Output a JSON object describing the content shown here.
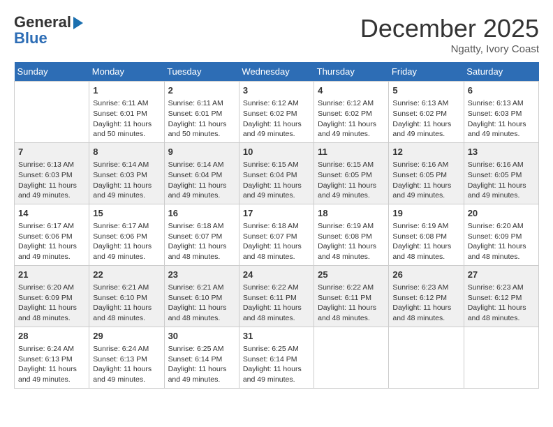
{
  "header": {
    "logo_line1": "General",
    "logo_line2": "Blue",
    "month": "December 2025",
    "location": "Ngatty, Ivory Coast"
  },
  "days_of_week": [
    "Sunday",
    "Monday",
    "Tuesday",
    "Wednesday",
    "Thursday",
    "Friday",
    "Saturday"
  ],
  "weeks": [
    [
      {
        "day": "",
        "sunrise": "",
        "sunset": "",
        "daylight": ""
      },
      {
        "day": "1",
        "sunrise": "Sunrise: 6:11 AM",
        "sunset": "Sunset: 6:01 PM",
        "daylight": "Daylight: 11 hours and 50 minutes."
      },
      {
        "day": "2",
        "sunrise": "Sunrise: 6:11 AM",
        "sunset": "Sunset: 6:01 PM",
        "daylight": "Daylight: 11 hours and 50 minutes."
      },
      {
        "day": "3",
        "sunrise": "Sunrise: 6:12 AM",
        "sunset": "Sunset: 6:02 PM",
        "daylight": "Daylight: 11 hours and 49 minutes."
      },
      {
        "day": "4",
        "sunrise": "Sunrise: 6:12 AM",
        "sunset": "Sunset: 6:02 PM",
        "daylight": "Daylight: 11 hours and 49 minutes."
      },
      {
        "day": "5",
        "sunrise": "Sunrise: 6:13 AM",
        "sunset": "Sunset: 6:02 PM",
        "daylight": "Daylight: 11 hours and 49 minutes."
      },
      {
        "day": "6",
        "sunrise": "Sunrise: 6:13 AM",
        "sunset": "Sunset: 6:03 PM",
        "daylight": "Daylight: 11 hours and 49 minutes."
      }
    ],
    [
      {
        "day": "7",
        "sunrise": "Sunrise: 6:13 AM",
        "sunset": "Sunset: 6:03 PM",
        "daylight": "Daylight: 11 hours and 49 minutes."
      },
      {
        "day": "8",
        "sunrise": "Sunrise: 6:14 AM",
        "sunset": "Sunset: 6:03 PM",
        "daylight": "Daylight: 11 hours and 49 minutes."
      },
      {
        "day": "9",
        "sunrise": "Sunrise: 6:14 AM",
        "sunset": "Sunset: 6:04 PM",
        "daylight": "Daylight: 11 hours and 49 minutes."
      },
      {
        "day": "10",
        "sunrise": "Sunrise: 6:15 AM",
        "sunset": "Sunset: 6:04 PM",
        "daylight": "Daylight: 11 hours and 49 minutes."
      },
      {
        "day": "11",
        "sunrise": "Sunrise: 6:15 AM",
        "sunset": "Sunset: 6:05 PM",
        "daylight": "Daylight: 11 hours and 49 minutes."
      },
      {
        "day": "12",
        "sunrise": "Sunrise: 6:16 AM",
        "sunset": "Sunset: 6:05 PM",
        "daylight": "Daylight: 11 hours and 49 minutes."
      },
      {
        "day": "13",
        "sunrise": "Sunrise: 6:16 AM",
        "sunset": "Sunset: 6:05 PM",
        "daylight": "Daylight: 11 hours and 49 minutes."
      }
    ],
    [
      {
        "day": "14",
        "sunrise": "Sunrise: 6:17 AM",
        "sunset": "Sunset: 6:06 PM",
        "daylight": "Daylight: 11 hours and 49 minutes."
      },
      {
        "day": "15",
        "sunrise": "Sunrise: 6:17 AM",
        "sunset": "Sunset: 6:06 PM",
        "daylight": "Daylight: 11 hours and 49 minutes."
      },
      {
        "day": "16",
        "sunrise": "Sunrise: 6:18 AM",
        "sunset": "Sunset: 6:07 PM",
        "daylight": "Daylight: 11 hours and 48 minutes."
      },
      {
        "day": "17",
        "sunrise": "Sunrise: 6:18 AM",
        "sunset": "Sunset: 6:07 PM",
        "daylight": "Daylight: 11 hours and 48 minutes."
      },
      {
        "day": "18",
        "sunrise": "Sunrise: 6:19 AM",
        "sunset": "Sunset: 6:08 PM",
        "daylight": "Daylight: 11 hours and 48 minutes."
      },
      {
        "day": "19",
        "sunrise": "Sunrise: 6:19 AM",
        "sunset": "Sunset: 6:08 PM",
        "daylight": "Daylight: 11 hours and 48 minutes."
      },
      {
        "day": "20",
        "sunrise": "Sunrise: 6:20 AM",
        "sunset": "Sunset: 6:09 PM",
        "daylight": "Daylight: 11 hours and 48 minutes."
      }
    ],
    [
      {
        "day": "21",
        "sunrise": "Sunrise: 6:20 AM",
        "sunset": "Sunset: 6:09 PM",
        "daylight": "Daylight: 11 hours and 48 minutes."
      },
      {
        "day": "22",
        "sunrise": "Sunrise: 6:21 AM",
        "sunset": "Sunset: 6:10 PM",
        "daylight": "Daylight: 11 hours and 48 minutes."
      },
      {
        "day": "23",
        "sunrise": "Sunrise: 6:21 AM",
        "sunset": "Sunset: 6:10 PM",
        "daylight": "Daylight: 11 hours and 48 minutes."
      },
      {
        "day": "24",
        "sunrise": "Sunrise: 6:22 AM",
        "sunset": "Sunset: 6:11 PM",
        "daylight": "Daylight: 11 hours and 48 minutes."
      },
      {
        "day": "25",
        "sunrise": "Sunrise: 6:22 AM",
        "sunset": "Sunset: 6:11 PM",
        "daylight": "Daylight: 11 hours and 48 minutes."
      },
      {
        "day": "26",
        "sunrise": "Sunrise: 6:23 AM",
        "sunset": "Sunset: 6:12 PM",
        "daylight": "Daylight: 11 hours and 48 minutes."
      },
      {
        "day": "27",
        "sunrise": "Sunrise: 6:23 AM",
        "sunset": "Sunset: 6:12 PM",
        "daylight": "Daylight: 11 hours and 48 minutes."
      }
    ],
    [
      {
        "day": "28",
        "sunrise": "Sunrise: 6:24 AM",
        "sunset": "Sunset: 6:13 PM",
        "daylight": "Daylight: 11 hours and 49 minutes."
      },
      {
        "day": "29",
        "sunrise": "Sunrise: 6:24 AM",
        "sunset": "Sunset: 6:13 PM",
        "daylight": "Daylight: 11 hours and 49 minutes."
      },
      {
        "day": "30",
        "sunrise": "Sunrise: 6:25 AM",
        "sunset": "Sunset: 6:14 PM",
        "daylight": "Daylight: 11 hours and 49 minutes."
      },
      {
        "day": "31",
        "sunrise": "Sunrise: 6:25 AM",
        "sunset": "Sunset: 6:14 PM",
        "daylight": "Daylight: 11 hours and 49 minutes."
      },
      {
        "day": "",
        "sunrise": "",
        "sunset": "",
        "daylight": ""
      },
      {
        "day": "",
        "sunrise": "",
        "sunset": "",
        "daylight": ""
      },
      {
        "day": "",
        "sunrise": "",
        "sunset": "",
        "daylight": ""
      }
    ]
  ]
}
